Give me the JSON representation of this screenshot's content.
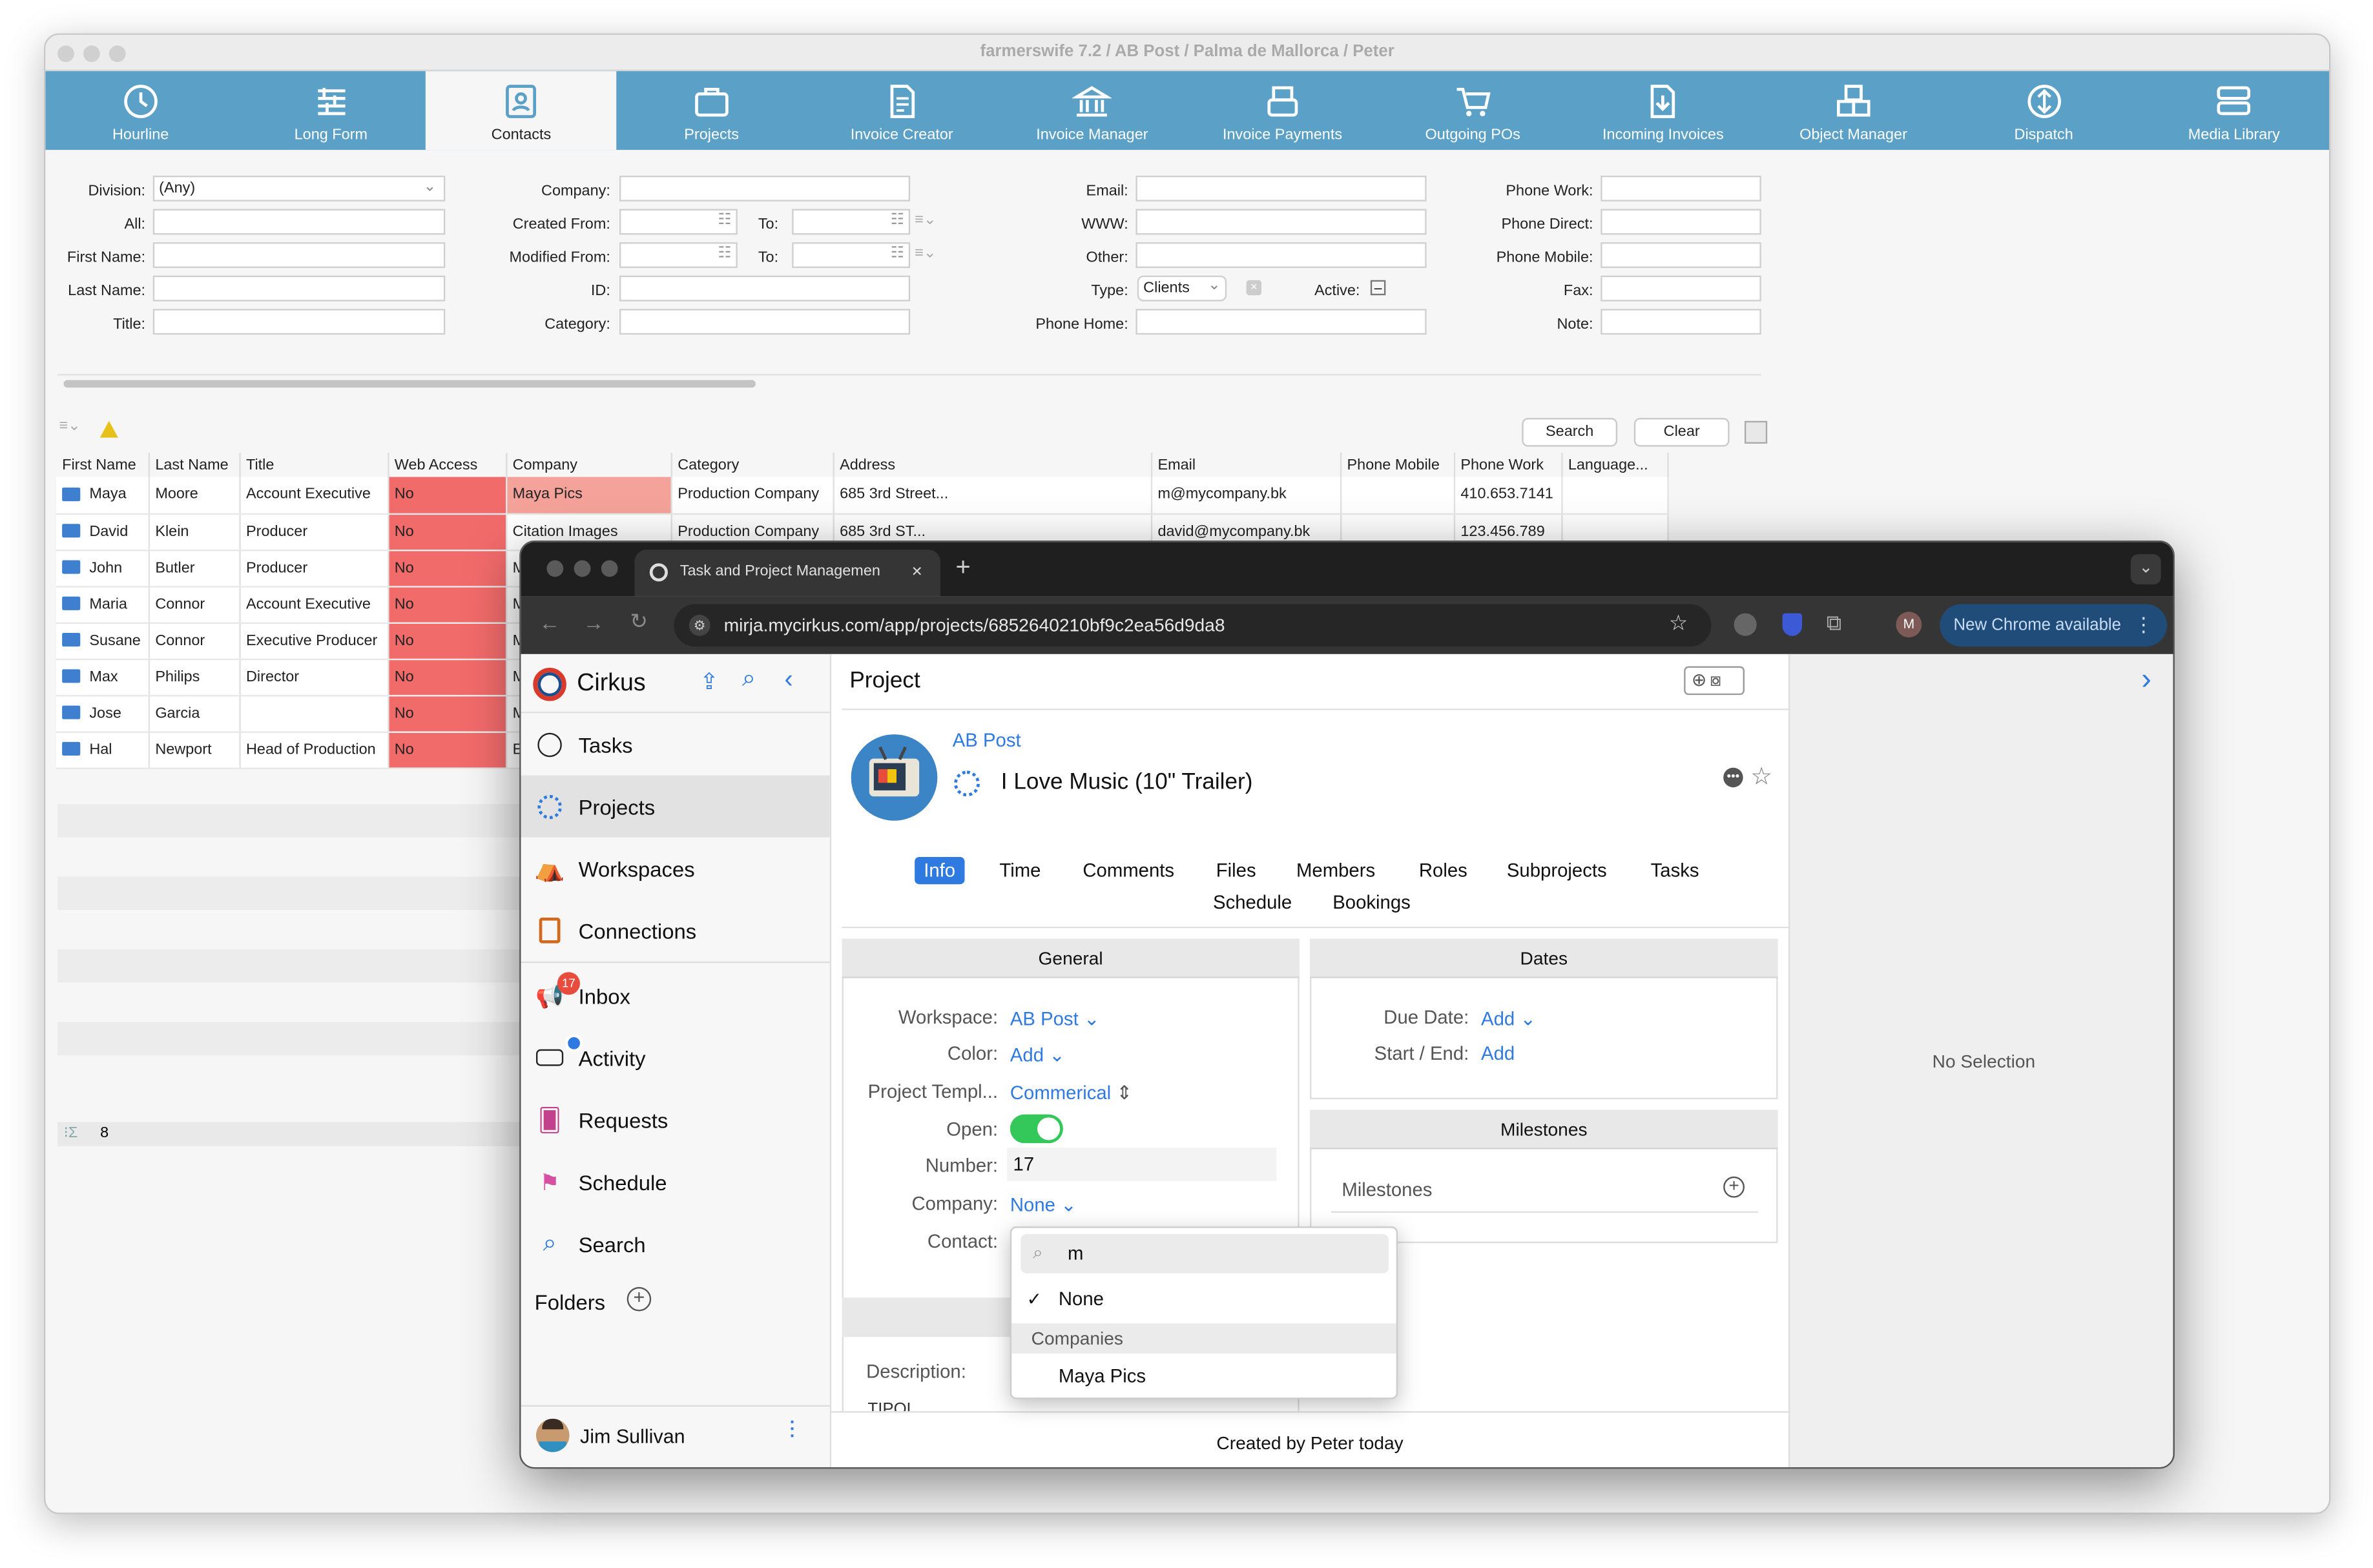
{
  "fw": {
    "title": "farmerswife 7.2   / AB Post / Palma de Mallorca / Peter",
    "ribbon": [
      {
        "label": "Hourline",
        "icon": "clock-icon"
      },
      {
        "label": "Long Form",
        "icon": "list-icon"
      },
      {
        "label": "Contacts",
        "icon": "contact-card-icon"
      },
      {
        "label": "Projects",
        "icon": "briefcase-icon"
      },
      {
        "label": "Invoice Creator",
        "icon": "document-icon"
      },
      {
        "label": "Invoice Manager",
        "icon": "bank-icon"
      },
      {
        "label": "Invoice Payments",
        "icon": "register-icon"
      },
      {
        "label": "Outgoing POs",
        "icon": "cart-icon"
      },
      {
        "label": "Incoming Invoices",
        "icon": "download-document-icon"
      },
      {
        "label": "Object Manager",
        "icon": "cubes-icon"
      },
      {
        "label": "Dispatch",
        "icon": "dispatch-icon"
      },
      {
        "label": "Media Library",
        "icon": "server-icon"
      }
    ],
    "filters": {
      "division_label": "Division:",
      "division_value": "(Any)",
      "all_label": "All:",
      "first_name_label": "First Name:",
      "last_name_label": "Last Name:",
      "title_label": "Title:",
      "company_label": "Company:",
      "created_from_label": "Created From:",
      "modified_from_label": "Modified From:",
      "to_label": "To:",
      "id_label": "ID:",
      "category_label": "Category:",
      "email_label": "Email:",
      "www_label": "WWW:",
      "other_label": "Other:",
      "type_label": "Type:",
      "type_value": "Clients",
      "active_label": "Active:",
      "phone_home_label": "Phone Home:",
      "phone_work_label": "Phone Work:",
      "phone_direct_label": "Phone Direct:",
      "phone_mobile_label": "Phone Mobile:",
      "fax_label": "Fax:",
      "note_label": "Note:"
    },
    "search_label": "Search",
    "clear_label": "Clear",
    "columns": [
      "First Name",
      "Last Name",
      "Title",
      "Web Access",
      "Company",
      "Category",
      "Address",
      "Email",
      "Phone Mobile",
      "Phone Work",
      "Language..."
    ],
    "rows": [
      [
        "Maya",
        "Moore",
        "Account Executive",
        "No",
        "Maya Pics",
        "Production Company",
        "685 3rd Street...",
        "m@mycompany.bk",
        "",
        "410.653.7141",
        ""
      ],
      [
        "David",
        "Klein",
        "Producer",
        "No",
        "Citation Images",
        "Production Company",
        "685 3rd ST...",
        "david@mycompany.bk",
        "",
        "123.456.789",
        ""
      ],
      [
        "John",
        "Butler",
        "Producer",
        "No",
        "M",
        "",
        "",
        "",
        "",
        "",
        ""
      ],
      [
        "Maria",
        "Connor",
        "Account Executive",
        "No",
        "M",
        "",
        "",
        "",
        "",
        "",
        ""
      ],
      [
        "Susane",
        "Connor",
        "Executive Producer",
        "No",
        "M",
        "",
        "",
        "",
        "",
        "",
        ""
      ],
      [
        "Max",
        "Philips",
        "Director",
        "No",
        "M",
        "",
        "",
        "",
        "",
        "",
        ""
      ],
      [
        "Jose",
        "Garcia",
        "",
        "No",
        "M",
        "",
        "",
        "",
        "",
        "",
        ""
      ],
      [
        "Hal",
        "Newport",
        "Head of Production",
        "No",
        "E",
        "",
        "",
        "",
        "",
        "",
        ""
      ]
    ],
    "count": "8"
  },
  "chrome": {
    "tab_title": "Task and Project Managemen",
    "url": "mirja.mycirkus.com/app/projects/6852640210bf9c2ea56d9da8",
    "update_label": "New Chrome available",
    "profile_initial": "M"
  },
  "cirkus": {
    "app_name": "Cirkus",
    "nav": [
      {
        "label": "Tasks",
        "icon": "circle-icon"
      },
      {
        "label": "Projects",
        "icon": "dotted-circle-icon"
      },
      {
        "label": "Workspaces",
        "icon": "tent-icon"
      },
      {
        "label": "Connections",
        "icon": "address-book-icon"
      },
      {
        "label": "Inbox",
        "icon": "megaphone-icon"
      },
      {
        "label": "Activity",
        "icon": "voicemail-icon"
      },
      {
        "label": "Requests",
        "icon": "cards-icon"
      },
      {
        "label": "Schedule",
        "icon": "signpost-icon"
      },
      {
        "label": "Search",
        "icon": "search-icon"
      }
    ],
    "inbox_badge": "17",
    "folders_label": "Folders",
    "user_name": "Jim Sullivan",
    "header": "Project",
    "workspace": "AB Post",
    "project_title": "I Love Music (10\" Trailer)",
    "tabs": [
      "Info",
      "Time",
      "Comments",
      "Files",
      "Members",
      "Roles",
      "Subprojects",
      "Tasks",
      "Schedule",
      "Bookings"
    ],
    "general_header": "General",
    "fields": {
      "workspace_label": "Workspace:",
      "workspace_value": "AB Post",
      "color_label": "Color:",
      "color_value": "Add",
      "template_label": "Project Templ...",
      "template_value": "Commerical",
      "open_label": "Open:",
      "number_label": "Number:",
      "number_value": "17",
      "company_label": "Company:",
      "company_value": "None",
      "contact_label": "Contact:",
      "description_label": "Description:",
      "description_peek": "TIPOL"
    },
    "dates_header": "Dates",
    "due_label": "Due Date:",
    "due_value": "Add",
    "startend_label": "Start / End:",
    "startend_value": "Add",
    "milestones_header": "Milestones",
    "milestones_label": "Milestones",
    "footer": "Created by Peter today",
    "no_selection": "No Selection",
    "dropdown": {
      "query": "m",
      "none": "None",
      "group": "Companies",
      "item": "Maya Pics"
    }
  },
  "colors": {
    "ribbon": "#5ba0c7",
    "web_access_no": "#f26b6b",
    "accent": "#2f7ae0",
    "toggle": "#34c759"
  }
}
